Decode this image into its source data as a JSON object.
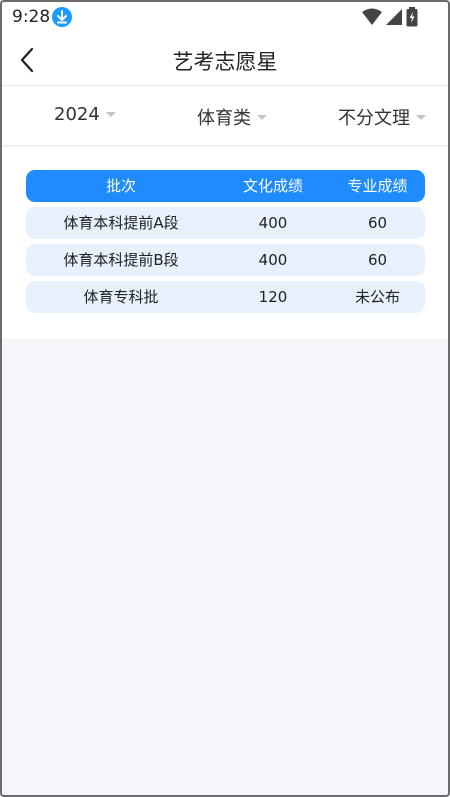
{
  "status_bar": {
    "time": "9:28"
  },
  "header": {
    "title": "艺考志愿星"
  },
  "filters": [
    {
      "label": "2024"
    },
    {
      "label": "体育类"
    },
    {
      "label": "不分文理"
    }
  ],
  "table": {
    "columns": [
      "批次",
      "文化成绩",
      "专业成绩"
    ],
    "rows": [
      {
        "batch": "体育本科提前A段",
        "culture_score": "400",
        "major_score": "60"
      },
      {
        "batch": "体育本科提前B段",
        "culture_score": "400",
        "major_score": "60"
      },
      {
        "batch": "体育专科批",
        "culture_score": "120",
        "major_score": "未公布"
      }
    ]
  },
  "colors": {
    "accent": "#1e8bff",
    "row_bg": "#e6f1fd",
    "page_bg": "#f4f6fa"
  }
}
